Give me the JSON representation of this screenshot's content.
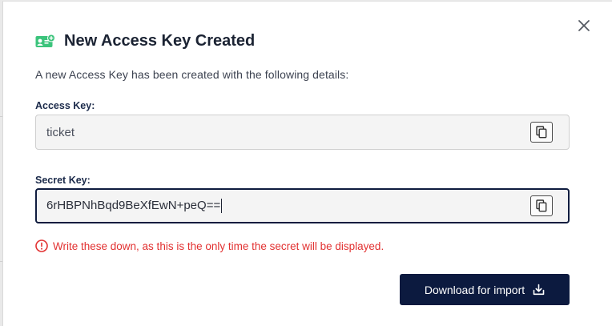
{
  "dialog": {
    "title": "New Access Key Created",
    "description": "A new Access Key has been created with the following details:",
    "title_icon": "id-card-add-icon",
    "close_icon": "close-icon"
  },
  "access_key": {
    "label": "Access Key:",
    "value": "ticket",
    "copy_icon": "copy-icon"
  },
  "secret_key": {
    "label": "Secret Key:",
    "value": "6rHBPNhBqd9BeXfEwN+peQ==",
    "copy_icon": "copy-icon"
  },
  "warning": {
    "text": "Write these down, as this is the only time the secret will be displayed.",
    "icon": "exclamation-circle-icon"
  },
  "actions": {
    "download_label": "Download for import",
    "download_icon": "download-icon"
  },
  "colors": {
    "primary": "#0c1a3f",
    "warning": "#e23131",
    "icon_accent": "#3cc47c"
  }
}
